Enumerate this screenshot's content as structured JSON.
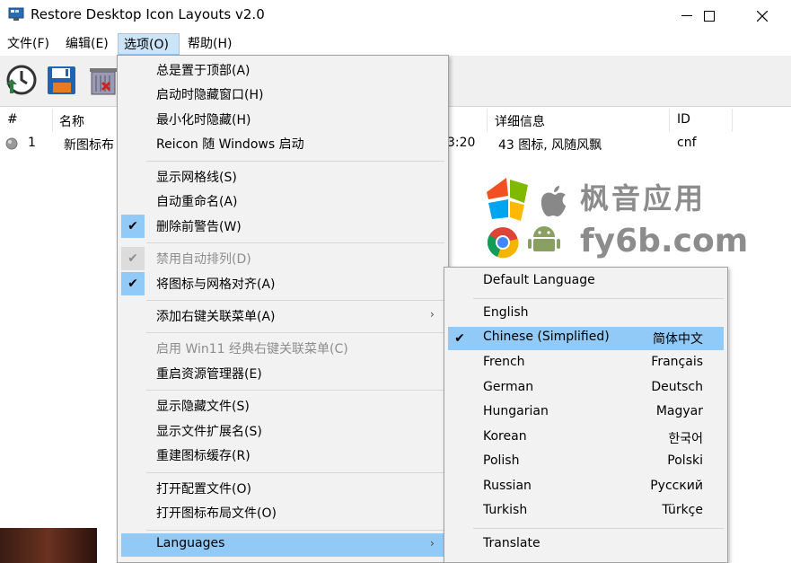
{
  "window": {
    "title": "Restore Desktop Icon Layouts v2.0",
    "minimize_glyph": "—",
    "maximize_glyph": "☐",
    "close_glyph": "✕"
  },
  "menubar": [
    {
      "label": "文件(F)"
    },
    {
      "label": "编辑(E)"
    },
    {
      "label": "选项(O)"
    },
    {
      "label": "帮助(H)"
    }
  ],
  "toolbar": {
    "icons": [
      "restore-clock-icon",
      "save-disk-icon",
      "delete-trash-icon"
    ]
  },
  "list": {
    "headers": {
      "num": "#",
      "name": "名称",
      "details": "详细信息",
      "id": "ID"
    },
    "rows": [
      {
        "num": "1",
        "name": "新图标布",
        "time_fragment": "3:20",
        "details": "43 图标, 风随风飘",
        "id": "cnf"
      }
    ]
  },
  "watermark": {
    "line1": "枫音应用",
    "line2": "fy6b.com"
  },
  "options_menu": {
    "items": [
      {
        "label": "总是置于顶部(A)"
      },
      {
        "label": "启动时隐藏窗口(H)"
      },
      {
        "label": "最小化时隐藏(H)"
      },
      {
        "label": "Reicon 随 Windows 启动"
      },
      {
        "label": "显示网格线(S)"
      },
      {
        "label": "自动重命名(A)"
      },
      {
        "label": "删除前警告(W)",
        "checked": true
      },
      {
        "label": "禁用自动排列(D)",
        "checked": true,
        "disabled": true
      },
      {
        "label": "将图标与网格对齐(A)",
        "checked": true
      },
      {
        "label": "添加右键关联菜单(A)",
        "submenu": true
      },
      {
        "label": "启用 Win11 经典右键关联菜单(C)",
        "disabled": true
      },
      {
        "label": "重启资源管理器(E)"
      },
      {
        "label": "显示隐藏文件(S)"
      },
      {
        "label": "显示文件扩展名(S)"
      },
      {
        "label": "重建图标缓存(R)"
      },
      {
        "label": "打开配置文件(O)"
      },
      {
        "label": "打开图标布局文件(O)"
      },
      {
        "label": "Languages",
        "submenu": true,
        "highlighted": true
      }
    ],
    "submenu_arrow": "›",
    "check_glyph": "✔"
  },
  "languages_menu": {
    "items": [
      {
        "label": "Default Language",
        "native": ""
      },
      {
        "label": "English",
        "native": ""
      },
      {
        "label": "Chinese (Simplified)",
        "native": "简体中文",
        "checked": true
      },
      {
        "label": "French",
        "native": "Français"
      },
      {
        "label": "German",
        "native": "Deutsch"
      },
      {
        "label": "Hungarian",
        "native": "Magyar"
      },
      {
        "label": "Korean",
        "native": "한국어"
      },
      {
        "label": "Polish",
        "native": "Polski"
      },
      {
        "label": "Russian",
        "native": "Русский"
      },
      {
        "label": "Turkish",
        "native": "Türkçe"
      },
      {
        "label": "Translate",
        "native": ""
      }
    ]
  }
}
